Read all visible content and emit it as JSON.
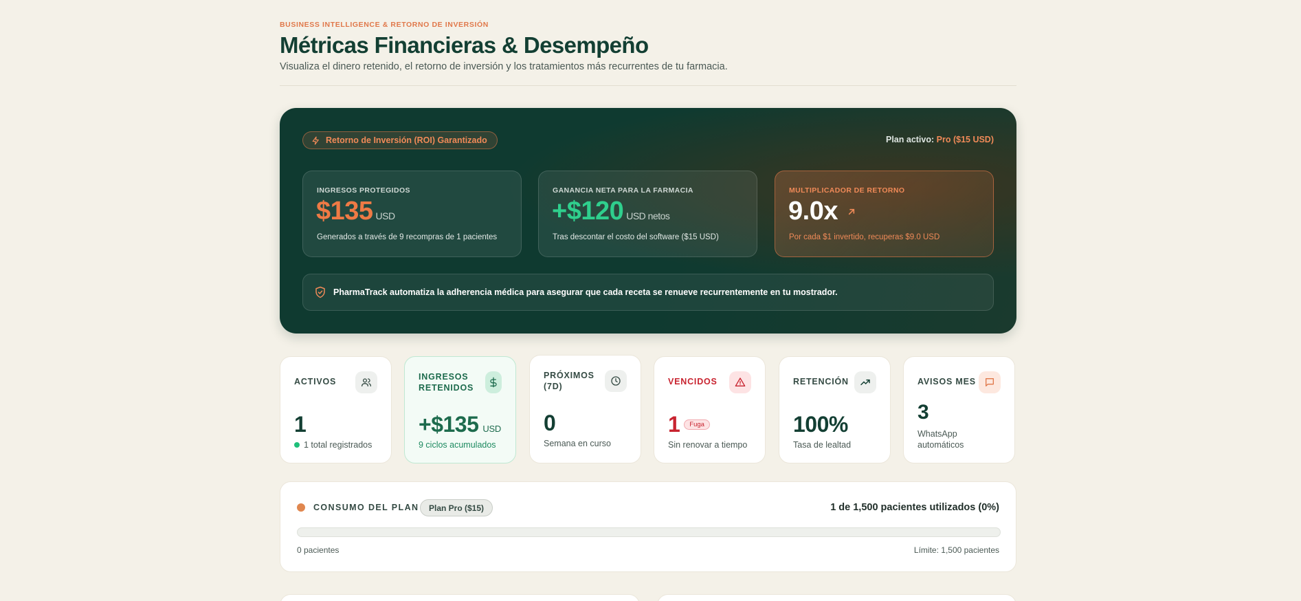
{
  "header": {
    "eyebrow": "BUSINESS INTELLIGENCE & RETORNO DE INVERSIÓN",
    "title": "Métricas Financieras & Desempeño",
    "subtitle": "Visualiza el dinero retenido, el retorno de inversión y los tratamientos más recurrentes de tu farmacia."
  },
  "hero": {
    "badge": "Retorno de Inversión (ROI) Garantizado",
    "plan_prefix": "Plan activo: ",
    "plan_name": "Pro ($15 USD)",
    "metrics": [
      {
        "label": "INGRESOS PROTEGIDOS",
        "value": "$135",
        "unit": "USD",
        "desc": "Generados a través de 9 recompras de 1 pacientes"
      },
      {
        "label": "GANANCIA NETA PARA LA FARMACIA",
        "value": "+$120",
        "unit": "USD netos",
        "desc": "Tras descontar el costo del software ($15 USD)"
      },
      {
        "label": "MULTIPLICADOR DE RETORNO",
        "value": "9.0x",
        "icon": "arrow-up-right-icon",
        "desc": "Por cada $1 invertido, recuperas $9.0 USD"
      }
    ],
    "notice": "PharmaTrack automatiza la adherencia médica para asegurar que cada receta se renueve recurrentemente en tu mostrador.",
    "accent": "#e0784a"
  },
  "stats": [
    {
      "label": "ACTIVOS",
      "icon": "users-icon",
      "value": "1",
      "sub": "1 total registrados"
    },
    {
      "label": "INGRESOS RETENIDOS",
      "icon": "dollar-icon",
      "value": "+$135",
      "unit": "USD",
      "sub": "9 ciclos acumulados"
    },
    {
      "label": "PRÓXIMOS (7D)",
      "icon": "clock-icon",
      "value": "0",
      "sub": "Semana en curso"
    },
    {
      "label": "VENCIDOS",
      "icon": "alert-triangle-icon",
      "value": "1",
      "badge": "Fuga",
      "sub": "Sin renovar a tiempo"
    },
    {
      "label": "RETENCIÓN",
      "icon": "trending-up-icon",
      "value": "100%",
      "sub": "Tasa de lealtad"
    },
    {
      "label": "AVISOS MES",
      "icon": "message-icon",
      "value": "3",
      "sub": "WhatsApp automáticos"
    }
  ],
  "usage": {
    "label": "CONSUMO DEL PLAN",
    "plan_pill": "Plan Pro ($15)",
    "count_text": "1 de 1,500 pacientes utilizados (0%)",
    "progress_percent": 0,
    "min_label": "0 pacientes",
    "max_label": "Límite: 1,500 pacientes"
  }
}
